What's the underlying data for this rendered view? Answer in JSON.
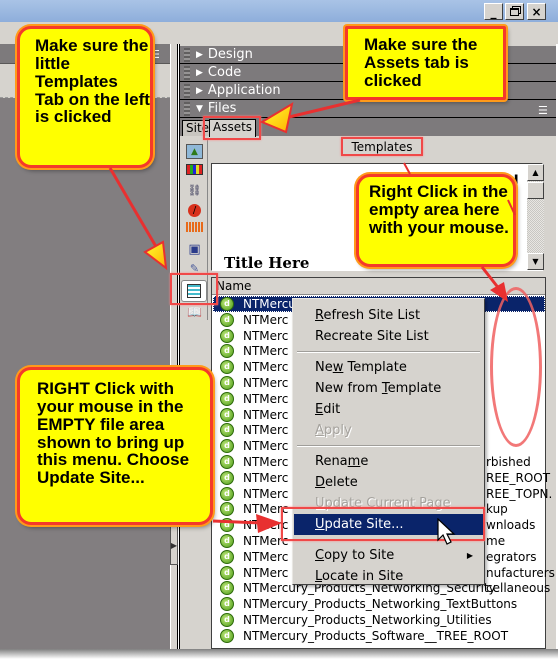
{
  "window": {
    "controls": {
      "minimize": "_",
      "restore": "🗗",
      "close": "×"
    }
  },
  "panel_groups": [
    {
      "label": "Design",
      "expanded": false
    },
    {
      "label": "Code",
      "expanded": false
    },
    {
      "label": "Application",
      "expanded": false
    },
    {
      "label": "Files",
      "expanded": true
    }
  ],
  "tabs": [
    {
      "label": "Site",
      "active": false
    },
    {
      "label": "Assets",
      "active": true
    }
  ],
  "asset_categories": [
    {
      "name": "images-icon",
      "glyph": "🖼",
      "active": false
    },
    {
      "name": "colors-icon",
      "glyph": "▦",
      "active": false
    },
    {
      "name": "urls-icon",
      "glyph": "🔗",
      "active": false
    },
    {
      "name": "flash-icon",
      "glyph": "⊘",
      "active": false
    },
    {
      "name": "shockwave-icon",
      "glyph": "|||",
      "active": false
    },
    {
      "name": "movies-icon",
      "glyph": "🎥",
      "active": false
    },
    {
      "name": "scripts-icon",
      "glyph": "✎",
      "active": false
    },
    {
      "name": "templates-icon",
      "glyph": "▤",
      "active": true
    },
    {
      "name": "library-icon",
      "glyph": "📖",
      "active": false
    }
  ],
  "assets": {
    "category_label": "Templates",
    "preview_title": "Title Here",
    "list_header": "Name",
    "files": [
      "NTMercury___SUPER",
      "NTMerc",
      "NTMerc",
      "NTMerc",
      "NTMerc",
      "NTMerc",
      "NTMerc",
      "NTMerc",
      "NTMerc",
      "NTMerc",
      "NTMerc",
      "NTMerc",
      "NTMerc",
      "NTMerc",
      "NTMerc",
      "NTMerc",
      "NTMerc",
      "NTMerc",
      "NTMercury_Products_Networking_Security",
      "NTMercury_Products_Networking_TextButtons",
      "NTMercury_Products_Networking_Utilities",
      "NTMercury_Products_Software__TREE_ROOT"
    ],
    "visible_suffixes": [
      {
        "row": 10,
        "text": "rbished"
      },
      {
        "row": 11,
        "text": "REE_ROOT"
      },
      {
        "row": 12,
        "text": "REE_TOPN."
      },
      {
        "row": 13,
        "text": "kup"
      },
      {
        "row": 14,
        "text": "wnloads"
      },
      {
        "row": 15,
        "text": "me"
      },
      {
        "row": 16,
        "text": "egrators"
      },
      {
        "row": 17,
        "text": "nufacturers"
      },
      {
        "row": 18,
        "text": "cellaneous"
      }
    ],
    "selected_index": 0
  },
  "context_menu": {
    "items": [
      {
        "label": "Refresh Site List",
        "mnemonic": "R",
        "enabled": true
      },
      {
        "label": "Recreate Site List",
        "enabled": true
      },
      {
        "separator": true
      },
      {
        "label": "New Template",
        "mnemonic": "w",
        "enabled": true
      },
      {
        "label": "New from Template",
        "mnemonic": "T",
        "enabled": true
      },
      {
        "label": "Edit",
        "mnemonic": "E",
        "enabled": true
      },
      {
        "label": "Apply",
        "mnemonic": "A",
        "enabled": false
      },
      {
        "separator": true
      },
      {
        "label": "Rename",
        "mnemonic": "m",
        "enabled": true
      },
      {
        "label": "Delete",
        "mnemonic": "D",
        "enabled": true
      },
      {
        "label": "Update Current Page",
        "mnemonic": "U",
        "enabled": false
      },
      {
        "label": "Update Site...",
        "mnemonic": "U",
        "enabled": true,
        "highlighted": true
      },
      {
        "separator": true
      },
      {
        "label": "Copy to Site",
        "mnemonic": "C",
        "enabled": true,
        "submenu": true
      },
      {
        "label": "Locate in Site",
        "mnemonic": "L",
        "enabled": true
      }
    ]
  },
  "callouts": {
    "templates_tab": "Make sure the little Templates Tab on the left is clicked",
    "assets_tab": "Make sure the Assets tab is clicked",
    "right_click_area": "Right Click in the empty area here with your mouse.",
    "right_click_menu": "RIGHT Click with your mouse in the EMPTY file area shown to bring up this menu. Choose Update Site..."
  },
  "colors": {
    "callout_fill": "#ffff00",
    "callout_border": "#f43a2a",
    "selection": "#0a246a",
    "panel_header": "#7d7a7c",
    "face": "#d6d3ce"
  }
}
